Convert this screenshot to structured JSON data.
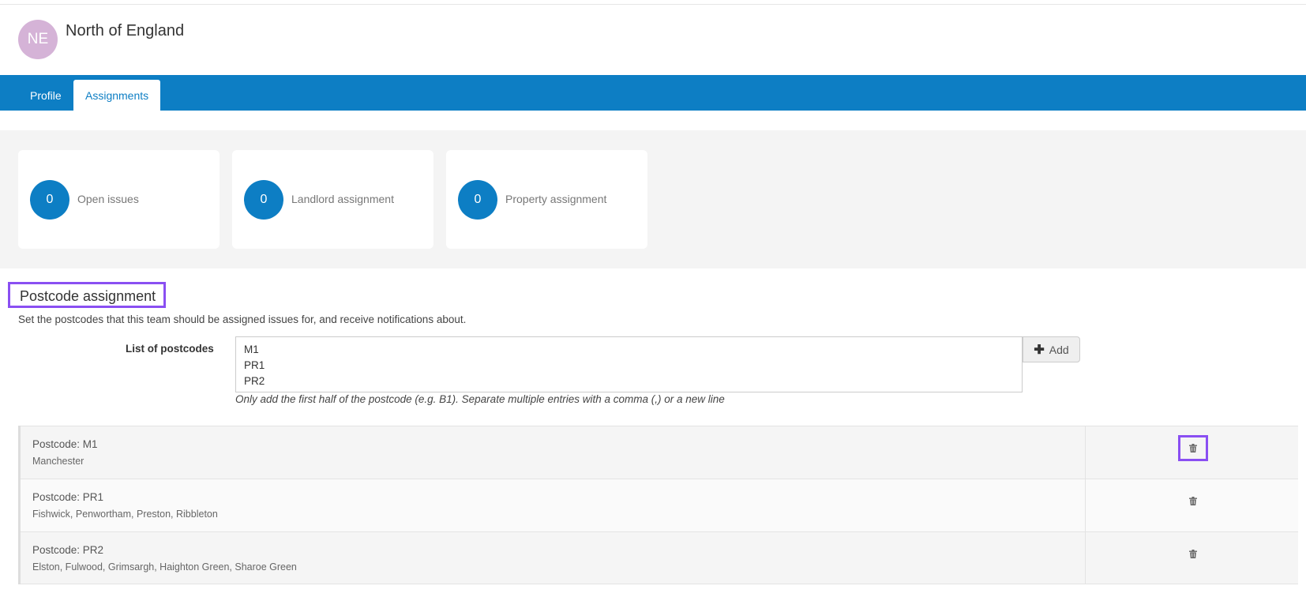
{
  "header": {
    "avatar_initials": "NE",
    "team_name": "North of England"
  },
  "tabs": [
    {
      "label": "Profile",
      "active": false
    },
    {
      "label": "Assignments",
      "active": true
    }
  ],
  "stats": [
    {
      "value": "0",
      "label": "Open issues"
    },
    {
      "value": "0",
      "label": "Landlord assignment"
    },
    {
      "value": "0",
      "label": "Property assignment"
    }
  ],
  "postcode_section": {
    "title": "Postcode assignment",
    "description": "Set the postcodes that this team should be assigned issues for, and receive notifications about.",
    "field_label": "List of postcodes",
    "textarea_value": "M1\nPR1\nPR2",
    "add_label": "Add",
    "help_text": "Only add the first half of the postcode (e.g. B1). Separate multiple entries with a comma (,) or a new line"
  },
  "postcodes": [
    {
      "title": "Postcode: M1",
      "areas": "Manchester"
    },
    {
      "title": "Postcode: PR1",
      "areas": "Fishwick, Penwortham, Preston, Ribbleton"
    },
    {
      "title": "Postcode: PR2",
      "areas": "Elston, Fulwood, Grimsargh, Haighton Green, Sharoe Green"
    }
  ],
  "icons": {
    "add": "plus-icon",
    "delete": "trash-icon"
  },
  "colors": {
    "primary": "#0d7ec4",
    "avatar": "#d5b3d7",
    "highlight": "#8a4ff2"
  }
}
